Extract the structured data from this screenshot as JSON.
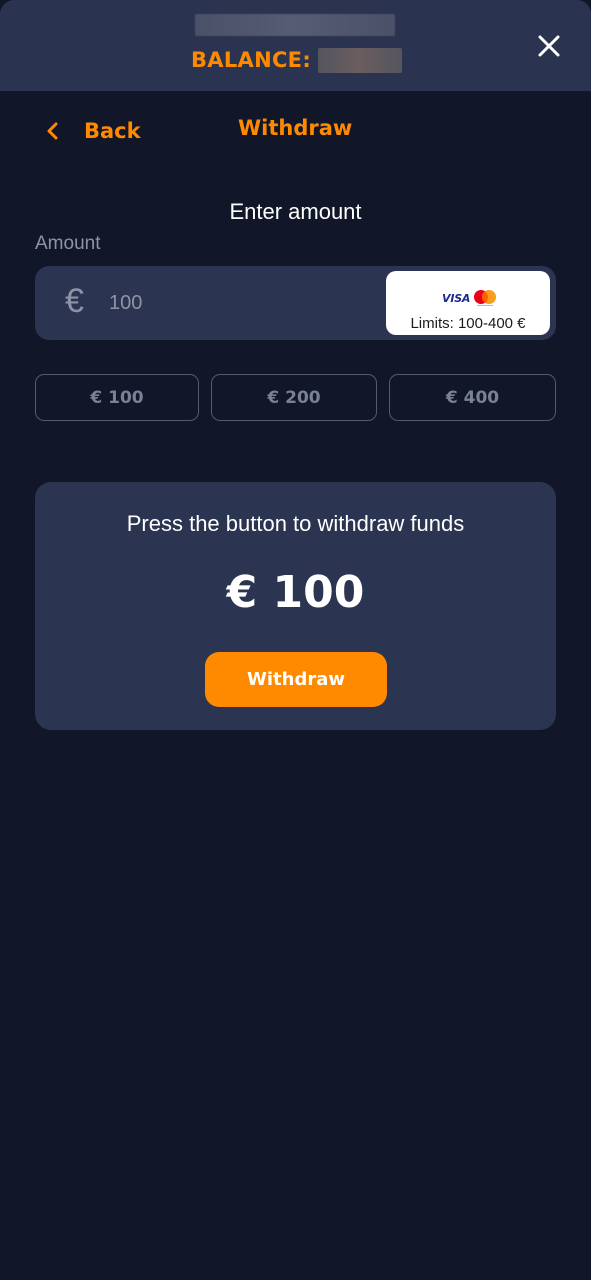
{
  "header": {
    "balance_label": "BALANCE:",
    "close_icon": "close-icon"
  },
  "nav": {
    "back_label": "Back",
    "title": "Withdraw",
    "back_icon": "chevron-left-icon"
  },
  "form": {
    "heading": "Enter amount",
    "amount_label": "Amount",
    "currency_symbol": "€",
    "amount_value": "100",
    "payment_method": {
      "brand_visa": "VISA",
      "brand_mastercard": "mastercard-icon",
      "limits": "Limits: 100-400 €"
    },
    "presets": [
      "€ 100",
      "€ 200",
      "€ 400"
    ]
  },
  "summary": {
    "prompt": "Press the button to withdraw funds",
    "amount": "€ 100",
    "button_label": "Withdraw"
  },
  "colors": {
    "background": "#111629",
    "header": "#2a3450",
    "card": "#2b3450",
    "accent": "#ff8a00",
    "muted": "#8e94a7"
  }
}
